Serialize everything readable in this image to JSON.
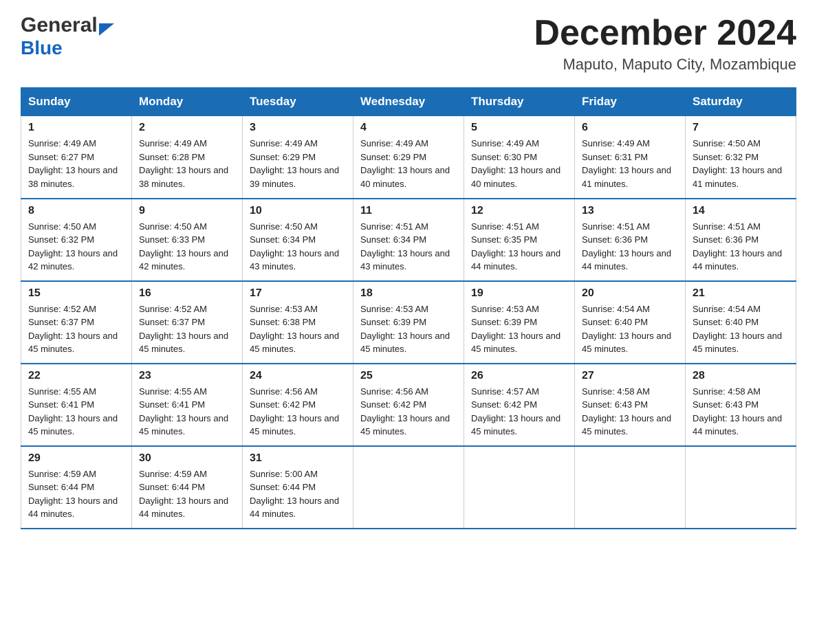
{
  "header": {
    "logo_general": "General",
    "logo_blue": "Blue",
    "month_title": "December 2024",
    "location": "Maputo, Maputo City, Mozambique"
  },
  "days_of_week": [
    "Sunday",
    "Monday",
    "Tuesday",
    "Wednesday",
    "Thursday",
    "Friday",
    "Saturday"
  ],
  "weeks": [
    [
      {
        "day": "1",
        "sunrise": "4:49 AM",
        "sunset": "6:27 PM",
        "daylight": "13 hours and 38 minutes."
      },
      {
        "day": "2",
        "sunrise": "4:49 AM",
        "sunset": "6:28 PM",
        "daylight": "13 hours and 38 minutes."
      },
      {
        "day": "3",
        "sunrise": "4:49 AM",
        "sunset": "6:29 PM",
        "daylight": "13 hours and 39 minutes."
      },
      {
        "day": "4",
        "sunrise": "4:49 AM",
        "sunset": "6:29 PM",
        "daylight": "13 hours and 40 minutes."
      },
      {
        "day": "5",
        "sunrise": "4:49 AM",
        "sunset": "6:30 PM",
        "daylight": "13 hours and 40 minutes."
      },
      {
        "day": "6",
        "sunrise": "4:49 AM",
        "sunset": "6:31 PM",
        "daylight": "13 hours and 41 minutes."
      },
      {
        "day": "7",
        "sunrise": "4:50 AM",
        "sunset": "6:32 PM",
        "daylight": "13 hours and 41 minutes."
      }
    ],
    [
      {
        "day": "8",
        "sunrise": "4:50 AM",
        "sunset": "6:32 PM",
        "daylight": "13 hours and 42 minutes."
      },
      {
        "day": "9",
        "sunrise": "4:50 AM",
        "sunset": "6:33 PM",
        "daylight": "13 hours and 42 minutes."
      },
      {
        "day": "10",
        "sunrise": "4:50 AM",
        "sunset": "6:34 PM",
        "daylight": "13 hours and 43 minutes."
      },
      {
        "day": "11",
        "sunrise": "4:51 AM",
        "sunset": "6:34 PM",
        "daylight": "13 hours and 43 minutes."
      },
      {
        "day": "12",
        "sunrise": "4:51 AM",
        "sunset": "6:35 PM",
        "daylight": "13 hours and 44 minutes."
      },
      {
        "day": "13",
        "sunrise": "4:51 AM",
        "sunset": "6:36 PM",
        "daylight": "13 hours and 44 minutes."
      },
      {
        "day": "14",
        "sunrise": "4:51 AM",
        "sunset": "6:36 PM",
        "daylight": "13 hours and 44 minutes."
      }
    ],
    [
      {
        "day": "15",
        "sunrise": "4:52 AM",
        "sunset": "6:37 PM",
        "daylight": "13 hours and 45 minutes."
      },
      {
        "day": "16",
        "sunrise": "4:52 AM",
        "sunset": "6:37 PM",
        "daylight": "13 hours and 45 minutes."
      },
      {
        "day": "17",
        "sunrise": "4:53 AM",
        "sunset": "6:38 PM",
        "daylight": "13 hours and 45 minutes."
      },
      {
        "day": "18",
        "sunrise": "4:53 AM",
        "sunset": "6:39 PM",
        "daylight": "13 hours and 45 minutes."
      },
      {
        "day": "19",
        "sunrise": "4:53 AM",
        "sunset": "6:39 PM",
        "daylight": "13 hours and 45 minutes."
      },
      {
        "day": "20",
        "sunrise": "4:54 AM",
        "sunset": "6:40 PM",
        "daylight": "13 hours and 45 minutes."
      },
      {
        "day": "21",
        "sunrise": "4:54 AM",
        "sunset": "6:40 PM",
        "daylight": "13 hours and 45 minutes."
      }
    ],
    [
      {
        "day": "22",
        "sunrise": "4:55 AM",
        "sunset": "6:41 PM",
        "daylight": "13 hours and 45 minutes."
      },
      {
        "day": "23",
        "sunrise": "4:55 AM",
        "sunset": "6:41 PM",
        "daylight": "13 hours and 45 minutes."
      },
      {
        "day": "24",
        "sunrise": "4:56 AM",
        "sunset": "6:42 PM",
        "daylight": "13 hours and 45 minutes."
      },
      {
        "day": "25",
        "sunrise": "4:56 AM",
        "sunset": "6:42 PM",
        "daylight": "13 hours and 45 minutes."
      },
      {
        "day": "26",
        "sunrise": "4:57 AM",
        "sunset": "6:42 PM",
        "daylight": "13 hours and 45 minutes."
      },
      {
        "day": "27",
        "sunrise": "4:58 AM",
        "sunset": "6:43 PM",
        "daylight": "13 hours and 45 minutes."
      },
      {
        "day": "28",
        "sunrise": "4:58 AM",
        "sunset": "6:43 PM",
        "daylight": "13 hours and 44 minutes."
      }
    ],
    [
      {
        "day": "29",
        "sunrise": "4:59 AM",
        "sunset": "6:44 PM",
        "daylight": "13 hours and 44 minutes."
      },
      {
        "day": "30",
        "sunrise": "4:59 AM",
        "sunset": "6:44 PM",
        "daylight": "13 hours and 44 minutes."
      },
      {
        "day": "31",
        "sunrise": "5:00 AM",
        "sunset": "6:44 PM",
        "daylight": "13 hours and 44 minutes."
      },
      null,
      null,
      null,
      null
    ]
  ],
  "labels": {
    "sunrise_prefix": "Sunrise: ",
    "sunset_prefix": "Sunset: ",
    "daylight_prefix": "Daylight: "
  }
}
